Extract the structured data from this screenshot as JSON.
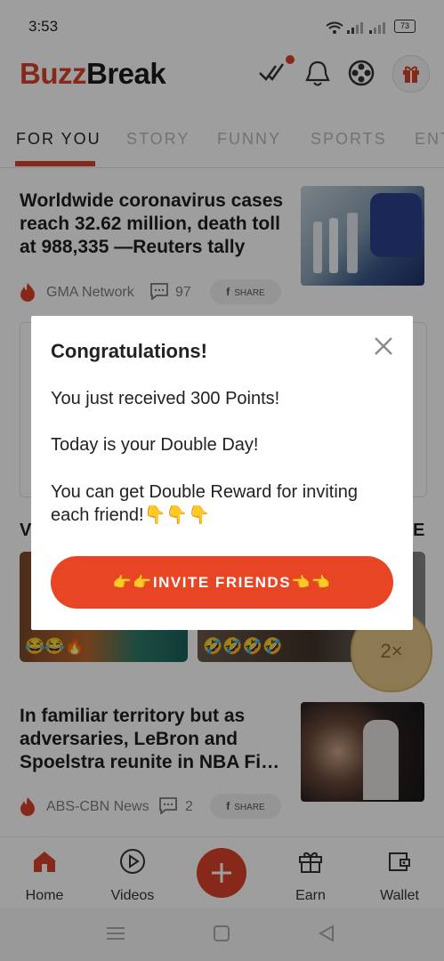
{
  "status_bar": {
    "time": "3:53",
    "battery": "73"
  },
  "header": {
    "logo_part1": "Buzz",
    "logo_part2": "Break"
  },
  "tabs": [
    "FOR YOU",
    "STORY",
    "FUNNY",
    "SPORTS",
    "ENT"
  ],
  "articles": [
    {
      "title": "Worldwide coronavirus cases reach 32.62 million, death toll at 988,335 —Reuters tally",
      "source": "GMA Network",
      "comments": "97",
      "share": "SHARE"
    },
    {
      "title": "In familiar territory but as adversaries, LeBron and Spoelstra reunite in NBA Fi…",
      "source": "ABS-CBN News",
      "comments": "2",
      "share": "SHARE"
    }
  ],
  "video_section": {
    "left_letter": "V",
    "right_letter": "E",
    "emoji_left": "😂😂🔥",
    "emoji_right": "🤣🤣🤣🤣"
  },
  "boost_badge": "2×",
  "bottom_nav": [
    {
      "label": "Home",
      "icon": "home-icon"
    },
    {
      "label": "Videos",
      "icon": "play-circle-icon"
    },
    {
      "label": "",
      "icon": "plus-icon"
    },
    {
      "label": "Earn",
      "icon": "gift-icon"
    },
    {
      "label": "Wallet",
      "icon": "wallet-icon"
    }
  ],
  "dialog": {
    "title": "Congratulations!",
    "line1": "You just received 300 Points!",
    "line2": "Today is your Double Day!",
    "line3": "You can get Double Reward for inviting each friend!👇👇👇",
    "button": "👉👉INVITE FRIENDS👈👈"
  },
  "colors": {
    "brand": "#d8432a",
    "button": "#e84524",
    "overlay": "rgba(0,0,0,0.38)"
  }
}
